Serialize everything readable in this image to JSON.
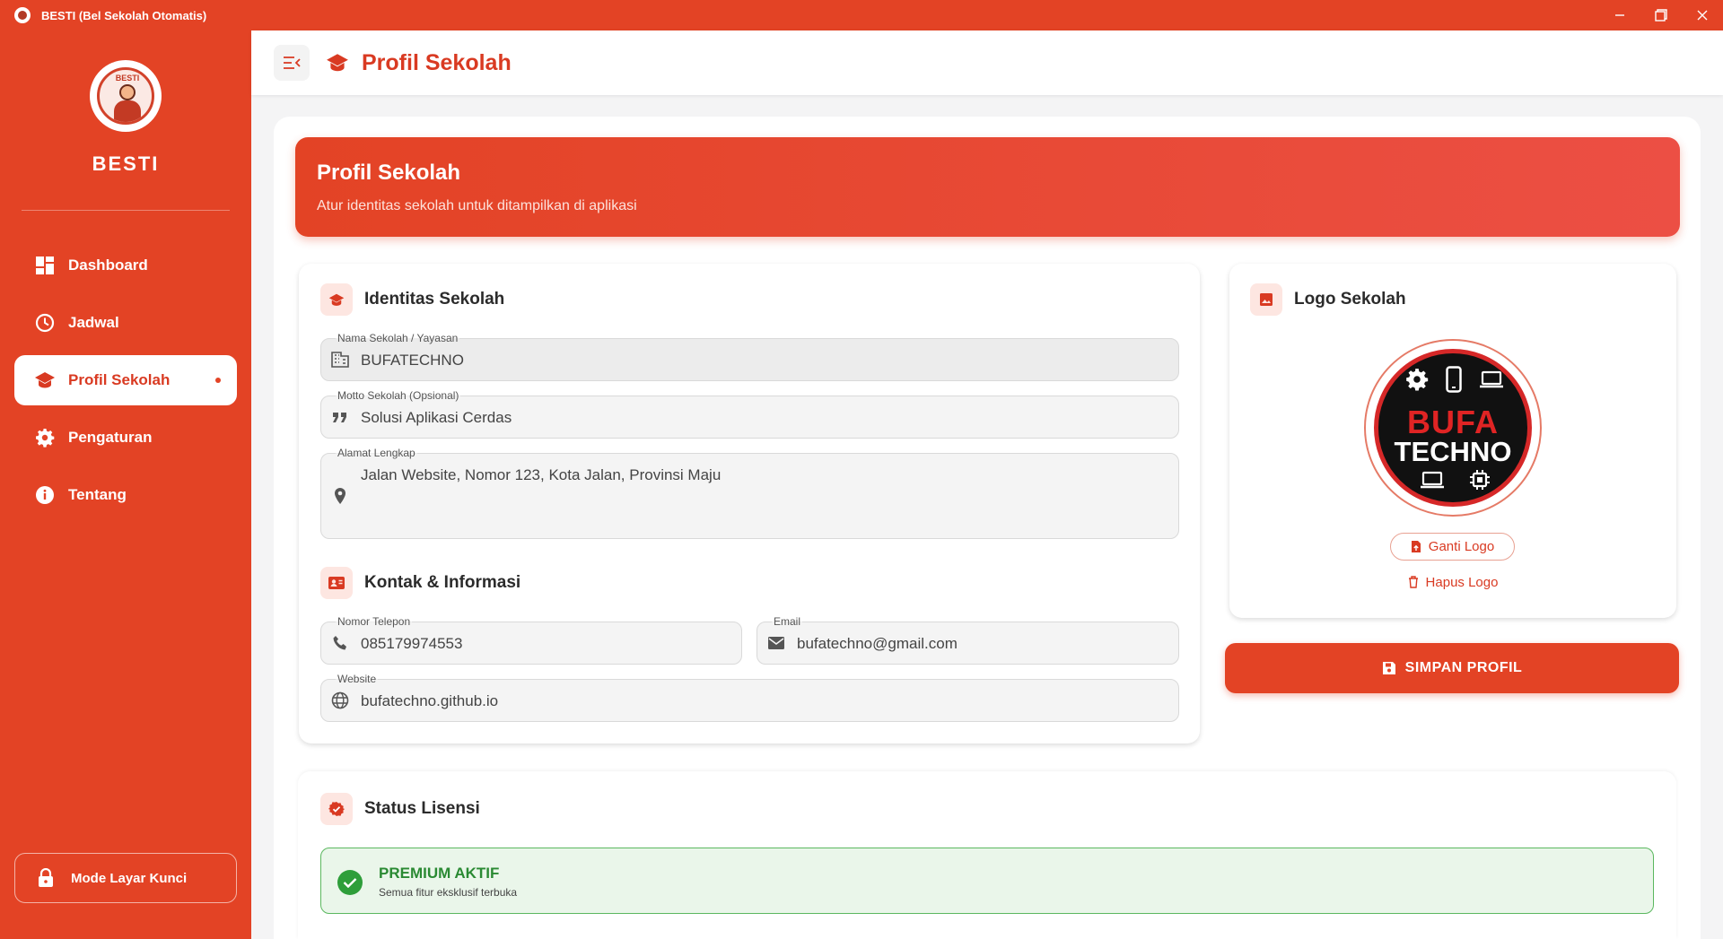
{
  "window": {
    "title": "BESTI (Bel Sekolah Otomatis)",
    "logo_text": "BESTI"
  },
  "sidebar": {
    "brand": "BESTI",
    "items": [
      {
        "label": "Dashboard",
        "icon": "dashboard-icon"
      },
      {
        "label": "Jadwal",
        "icon": "clock-icon"
      },
      {
        "label": "Profil Sekolah",
        "icon": "school-icon",
        "active": true
      },
      {
        "label": "Pengaturan",
        "icon": "gear-icon"
      },
      {
        "label": "Tentang",
        "icon": "info-icon"
      }
    ],
    "lock_button": "Mode Layar Kunci"
  },
  "header": {
    "title": "Profil Sekolah"
  },
  "hero": {
    "title": "Profil Sekolah",
    "subtitle": "Atur identitas sekolah untuk ditampilkan di aplikasi"
  },
  "identitas": {
    "title": "Identitas Sekolah",
    "nama_label": "Nama Sekolah / Yayasan",
    "nama_value": "BUFATECHNO",
    "motto_label": "Motto Sekolah (Opsional)",
    "motto_value": "Solusi Aplikasi Cerdas",
    "alamat_label": "Alamat Lengkap",
    "alamat_value": "Jalan Website, Nomor 123, Kota Jalan, Provinsi Maju"
  },
  "kontak": {
    "title": "Kontak & Informasi",
    "telepon_label": "Nomor Telepon",
    "telepon_value": "085179974553",
    "email_label": "Email",
    "email_value": "bufatechno@gmail.com",
    "website_label": "Website",
    "website_value": "bufatechno.github.io"
  },
  "logo": {
    "title": "Logo Sekolah",
    "text_line1": "BUFA",
    "text_line2": "TECHNO",
    "ganti_label": "Ganti Logo",
    "hapus_label": "Hapus Logo"
  },
  "save_button": "SIMPAN PROFIL",
  "lisensi": {
    "title": "Status Lisensi",
    "status": "PREMIUM AKTIF",
    "desc": "Semua fitur eksklusif terbuka"
  },
  "colors": {
    "primary": "#e34325",
    "success": "#2e9e3a"
  }
}
